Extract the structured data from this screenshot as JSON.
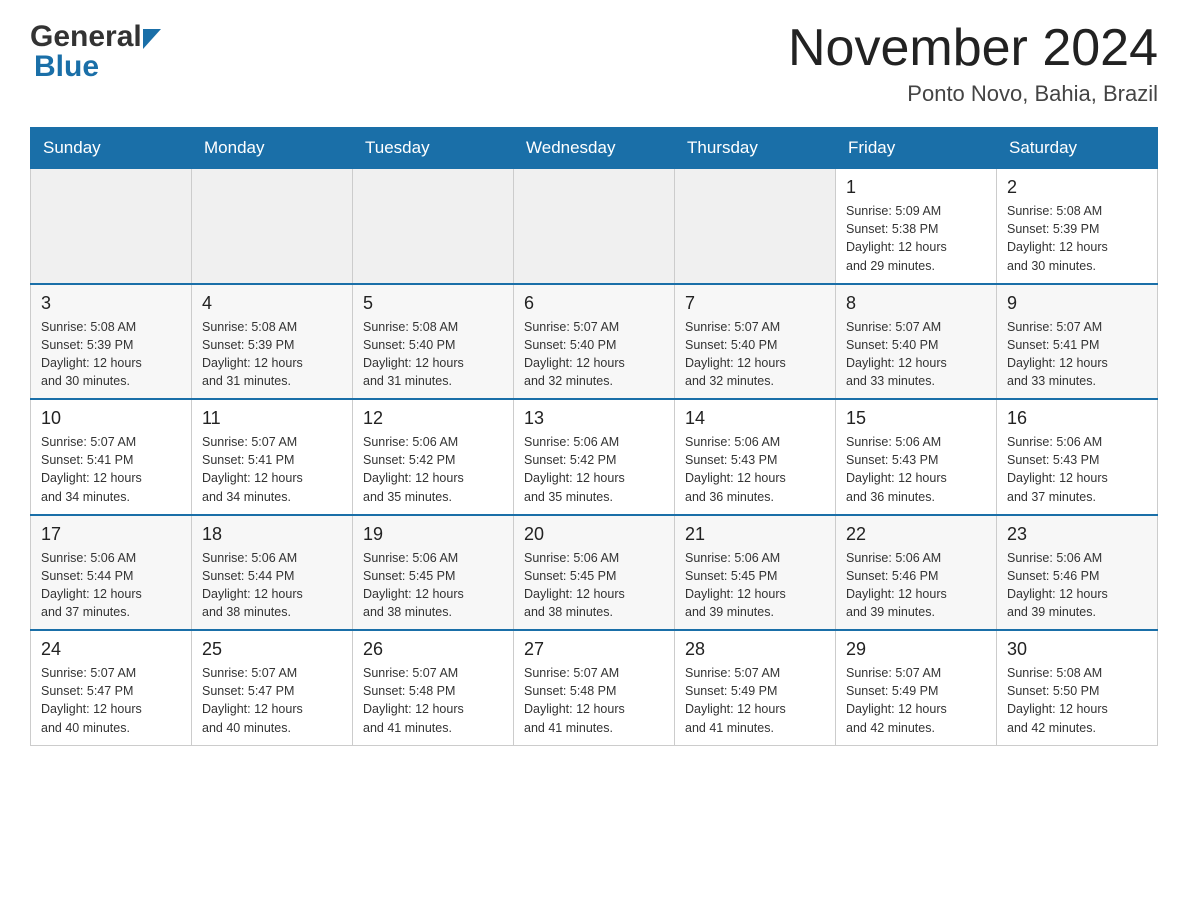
{
  "header": {
    "logo_general": "General",
    "logo_blue": "Blue",
    "month_title": "November 2024",
    "location": "Ponto Novo, Bahia, Brazil"
  },
  "days_of_week": [
    "Sunday",
    "Monday",
    "Tuesday",
    "Wednesday",
    "Thursday",
    "Friday",
    "Saturday"
  ],
  "weeks": [
    [
      {
        "day": "",
        "info": ""
      },
      {
        "day": "",
        "info": ""
      },
      {
        "day": "",
        "info": ""
      },
      {
        "day": "",
        "info": ""
      },
      {
        "day": "",
        "info": ""
      },
      {
        "day": "1",
        "info": "Sunrise: 5:09 AM\nSunset: 5:38 PM\nDaylight: 12 hours\nand 29 minutes."
      },
      {
        "day": "2",
        "info": "Sunrise: 5:08 AM\nSunset: 5:39 PM\nDaylight: 12 hours\nand 30 minutes."
      }
    ],
    [
      {
        "day": "3",
        "info": "Sunrise: 5:08 AM\nSunset: 5:39 PM\nDaylight: 12 hours\nand 30 minutes."
      },
      {
        "day": "4",
        "info": "Sunrise: 5:08 AM\nSunset: 5:39 PM\nDaylight: 12 hours\nand 31 minutes."
      },
      {
        "day": "5",
        "info": "Sunrise: 5:08 AM\nSunset: 5:40 PM\nDaylight: 12 hours\nand 31 minutes."
      },
      {
        "day": "6",
        "info": "Sunrise: 5:07 AM\nSunset: 5:40 PM\nDaylight: 12 hours\nand 32 minutes."
      },
      {
        "day": "7",
        "info": "Sunrise: 5:07 AM\nSunset: 5:40 PM\nDaylight: 12 hours\nand 32 minutes."
      },
      {
        "day": "8",
        "info": "Sunrise: 5:07 AM\nSunset: 5:40 PM\nDaylight: 12 hours\nand 33 minutes."
      },
      {
        "day": "9",
        "info": "Sunrise: 5:07 AM\nSunset: 5:41 PM\nDaylight: 12 hours\nand 33 minutes."
      }
    ],
    [
      {
        "day": "10",
        "info": "Sunrise: 5:07 AM\nSunset: 5:41 PM\nDaylight: 12 hours\nand 34 minutes."
      },
      {
        "day": "11",
        "info": "Sunrise: 5:07 AM\nSunset: 5:41 PM\nDaylight: 12 hours\nand 34 minutes."
      },
      {
        "day": "12",
        "info": "Sunrise: 5:06 AM\nSunset: 5:42 PM\nDaylight: 12 hours\nand 35 minutes."
      },
      {
        "day": "13",
        "info": "Sunrise: 5:06 AM\nSunset: 5:42 PM\nDaylight: 12 hours\nand 35 minutes."
      },
      {
        "day": "14",
        "info": "Sunrise: 5:06 AM\nSunset: 5:43 PM\nDaylight: 12 hours\nand 36 minutes."
      },
      {
        "day": "15",
        "info": "Sunrise: 5:06 AM\nSunset: 5:43 PM\nDaylight: 12 hours\nand 36 minutes."
      },
      {
        "day": "16",
        "info": "Sunrise: 5:06 AM\nSunset: 5:43 PM\nDaylight: 12 hours\nand 37 minutes."
      }
    ],
    [
      {
        "day": "17",
        "info": "Sunrise: 5:06 AM\nSunset: 5:44 PM\nDaylight: 12 hours\nand 37 minutes."
      },
      {
        "day": "18",
        "info": "Sunrise: 5:06 AM\nSunset: 5:44 PM\nDaylight: 12 hours\nand 38 minutes."
      },
      {
        "day": "19",
        "info": "Sunrise: 5:06 AM\nSunset: 5:45 PM\nDaylight: 12 hours\nand 38 minutes."
      },
      {
        "day": "20",
        "info": "Sunrise: 5:06 AM\nSunset: 5:45 PM\nDaylight: 12 hours\nand 38 minutes."
      },
      {
        "day": "21",
        "info": "Sunrise: 5:06 AM\nSunset: 5:45 PM\nDaylight: 12 hours\nand 39 minutes."
      },
      {
        "day": "22",
        "info": "Sunrise: 5:06 AM\nSunset: 5:46 PM\nDaylight: 12 hours\nand 39 minutes."
      },
      {
        "day": "23",
        "info": "Sunrise: 5:06 AM\nSunset: 5:46 PM\nDaylight: 12 hours\nand 39 minutes."
      }
    ],
    [
      {
        "day": "24",
        "info": "Sunrise: 5:07 AM\nSunset: 5:47 PM\nDaylight: 12 hours\nand 40 minutes."
      },
      {
        "day": "25",
        "info": "Sunrise: 5:07 AM\nSunset: 5:47 PM\nDaylight: 12 hours\nand 40 minutes."
      },
      {
        "day": "26",
        "info": "Sunrise: 5:07 AM\nSunset: 5:48 PM\nDaylight: 12 hours\nand 41 minutes."
      },
      {
        "day": "27",
        "info": "Sunrise: 5:07 AM\nSunset: 5:48 PM\nDaylight: 12 hours\nand 41 minutes."
      },
      {
        "day": "28",
        "info": "Sunrise: 5:07 AM\nSunset: 5:49 PM\nDaylight: 12 hours\nand 41 minutes."
      },
      {
        "day": "29",
        "info": "Sunrise: 5:07 AM\nSunset: 5:49 PM\nDaylight: 12 hours\nand 42 minutes."
      },
      {
        "day": "30",
        "info": "Sunrise: 5:08 AM\nSunset: 5:50 PM\nDaylight: 12 hours\nand 42 minutes."
      }
    ]
  ]
}
